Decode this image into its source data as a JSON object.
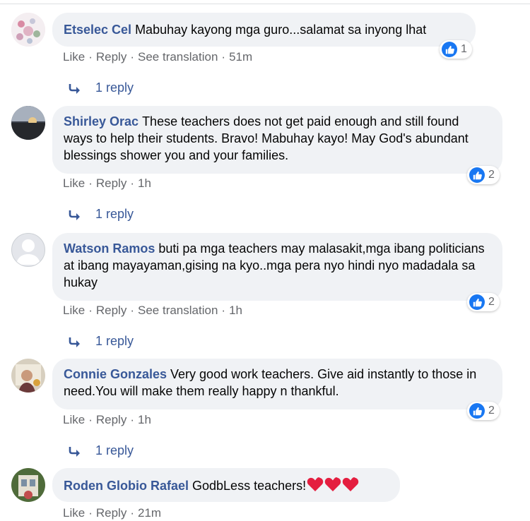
{
  "comments": [
    {
      "name": "Etselec Cel",
      "text": "Mabuhay kayong mga guro...salamat sa inyong lhat",
      "actions": [
        "Like",
        "Reply",
        "See translation",
        "51m"
      ],
      "reactions": "1",
      "replies": "1 reply"
    },
    {
      "name": "Shirley Orac",
      "text": "These teachers does not get paid enough and still found ways to help their students. Bravo! Mabuhay kayo! May God's abundant blessings shower you and your families.",
      "actions": [
        "Like",
        "Reply",
        "1h"
      ],
      "reactions": "2",
      "replies": "1 reply"
    },
    {
      "name": "Watson Ramos",
      "text": "buti pa mga teachers may malasakit,mga ibang politicians at ibang mayayaman,gising na kyo..mga pera nyo hindi nyo madadala sa hukay",
      "actions": [
        "Like",
        "Reply",
        "See translation",
        "1h"
      ],
      "reactions": "2",
      "replies": "1 reply"
    },
    {
      "name": "Connie Gonzales",
      "text": "Very good work teachers. Give aid instantly to those in need.You will make them really happy n thankful.",
      "actions": [
        "Like",
        "Reply",
        "1h"
      ],
      "reactions": "2",
      "replies": "1 reply"
    },
    {
      "name": "Roden Globio Rafael",
      "text": "GodbLess teachers!",
      "actions": [
        "Like",
        "Reply",
        "21m"
      ],
      "hearts": 3
    }
  ]
}
